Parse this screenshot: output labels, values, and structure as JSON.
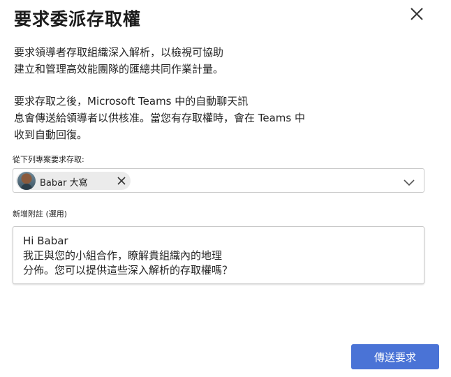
{
  "dialog": {
    "title": "要求委派存取權",
    "close_icon": "close-icon",
    "intro_paragraph": "要求領導者存取組織深入解析，以檢視可協助\n建立和管理高效能團隊的匯總共同作業計量。",
    "teams_paragraph": "要求存取之後，Microsoft Teams 中的自動聊天訊\n息會傳送給領導者以供核准。當您有存取權時，會在 Teams 中\n收到自動回復。"
  },
  "expert_picker": {
    "label": "從下列專案要求存取:",
    "selected_chip": {
      "name": "Babar 大寫",
      "avatar_icon": "avatar",
      "remove_icon": "close-icon"
    },
    "chevron_icon": "chevron-down-icon"
  },
  "note": {
    "label": "新增附註 (選用)",
    "value": "Hi Babar\n我正與您的小組合作，瞭解貴組織內的地理\n分佈。您可以提供這些深入解析的存取權嗎？"
  },
  "actions": {
    "send_label": "傳送要求",
    "accent_color": "#4a73d6"
  }
}
